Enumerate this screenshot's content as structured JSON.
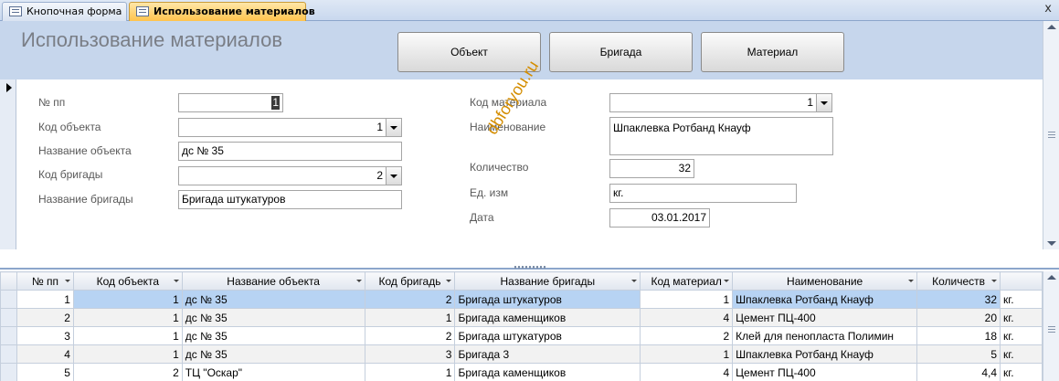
{
  "tabs": [
    {
      "label": "Кнопочная форма",
      "active": false
    },
    {
      "label": "Использование материалов",
      "active": true
    }
  ],
  "close_glyph": "x",
  "form": {
    "title": "Использование материалов",
    "buttons": {
      "object": "Объект",
      "brigade": "Бригада",
      "material": "Материал"
    },
    "fields": {
      "np_label": "№ пп",
      "np_value": "1",
      "obj_code_label": "Код объекта",
      "obj_code_value": "1",
      "obj_name_label": "Название объекта",
      "obj_name_value": "дс № 35",
      "brig_code_label": "Код бригады",
      "brig_code_value": "2",
      "brig_name_label": "Название бригады",
      "brig_name_value": "Бригада штукатуров",
      "mat_code_label": "Код материала",
      "mat_code_value": "1",
      "name_label": "Наименование",
      "name_value": "Шпаклевка Ротбанд Кнауф",
      "qty_label": "Количество",
      "qty_value": "32",
      "unit_label": "Ед. изм",
      "unit_value": "кг.",
      "date_label": "Дата",
      "date_value": "03.01.2017"
    },
    "watermark": "dbforyou.ru"
  },
  "datasheet": {
    "columns": [
      "№ пп",
      "Код объекта",
      "Название объекта",
      "Код бригадь",
      "Название бригады",
      "Код материал",
      "Наименование",
      "Количеств",
      ""
    ],
    "rows": [
      [
        "1",
        "1",
        "дс № 35",
        "2",
        "Бригада штукатуров",
        "1",
        "Шпаклевка Ротбанд Кнауф",
        "32",
        "кг."
      ],
      [
        "2",
        "1",
        "дс № 35",
        "1",
        "Бригада каменщиков",
        "4",
        "Цемент ПЦ-400",
        "20",
        "кг."
      ],
      [
        "3",
        "1",
        "дс № 35",
        "2",
        "Бригада штукатуров",
        "2",
        "Клей для пенопласта Полимин",
        "18",
        "кг."
      ],
      [
        "4",
        "1",
        "дс № 35",
        "3",
        "Бригада 3",
        "1",
        "Шпаклевка Ротбанд Кнауф",
        "5",
        "кг."
      ],
      [
        "5",
        "2",
        "ТЦ \"Оскар\"",
        "1",
        "Бригада каменщиков",
        "4",
        "Цемент ПЦ-400",
        "4,4",
        "кг."
      ]
    ]
  },
  "colors": {
    "active_tab": "#ffc34d",
    "header_band": "#c6d6ec",
    "current_row": "#b7d3f3",
    "watermark": "#d48d00"
  }
}
